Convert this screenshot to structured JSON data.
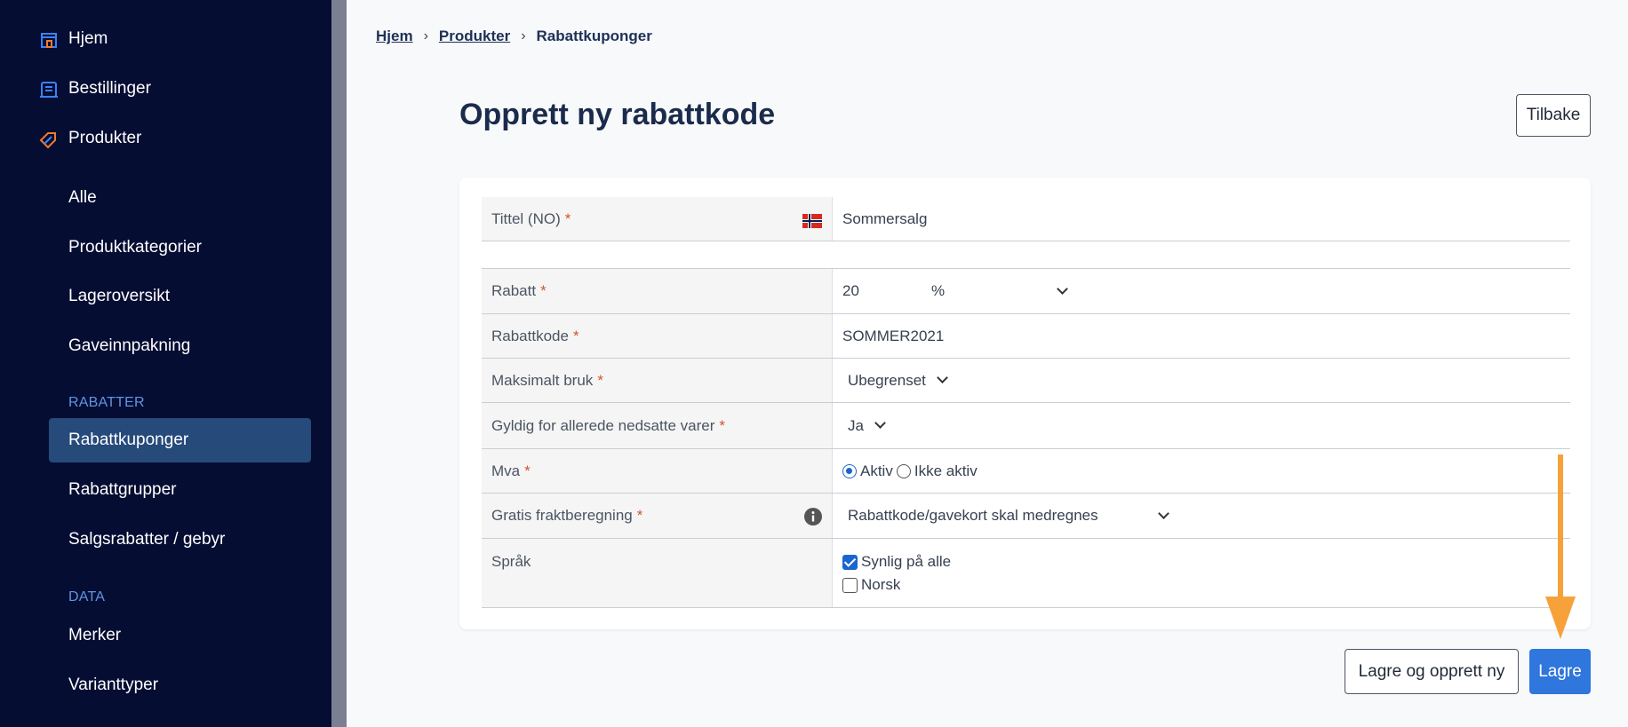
{
  "sidebar": {
    "top_items": [
      {
        "label": "Hjem",
        "icon": "home-icon"
      },
      {
        "label": "Bestillinger",
        "icon": "orders-icon"
      },
      {
        "label": "Produkter",
        "icon": "tag-icon"
      }
    ],
    "sub_items": [
      "Alle",
      "Produktkategorier",
      "Lageroversikt",
      "Gaveinnpakning"
    ],
    "section_rabatter": "RABATTER",
    "rabatter_items": [
      "Rabattkuponger",
      "Rabattgrupper",
      "Salgsrabatter / gebyr"
    ],
    "section_data": "DATA",
    "data_items": [
      "Merker",
      "Varianttyper"
    ],
    "active_item": "Rabattkuponger",
    "colors": {
      "background": "#050d33",
      "active": "#264a7a",
      "section": "#5f95e6",
      "icon_accent": "#f07b2b",
      "icon_blue": "#3b82f6"
    }
  },
  "breadcrumb": {
    "items": [
      "Hjem",
      "Produkter"
    ],
    "current": "Rabattkuponger",
    "separator": "›"
  },
  "page": {
    "title": "Opprett ny rabattkode",
    "back_label": "Tilbake"
  },
  "form": {
    "title_row": {
      "label": "Tittel (NO)",
      "required": "*",
      "flag_icon": "norway-flag-icon",
      "value": "Sommersalg"
    },
    "rabatt": {
      "label": "Rabatt",
      "required": "*",
      "value": "20",
      "unit": "%"
    },
    "rabattkode": {
      "label": "Rabattkode",
      "required": "*",
      "value": "SOMMER2021"
    },
    "maksimalt_bruk": {
      "label": "Maksimalt bruk",
      "required": "*",
      "value": "Ubegrenset"
    },
    "gyldig": {
      "label": "Gyldig for allerede nedsatte varer",
      "required": "*",
      "value": "Ja"
    },
    "mva": {
      "label": "Mva",
      "required": "*",
      "options": [
        "Aktiv",
        "Ikke aktiv"
      ],
      "selected": "Aktiv"
    },
    "gratis_frakt": {
      "label": "Gratis fraktberegning",
      "required": "*",
      "info_icon": "info-icon",
      "value": "Rabattkode/gavekort skal medregnes"
    },
    "sprak": {
      "label": "Språk",
      "options": [
        {
          "label": "Synlig på alle",
          "checked": true
        },
        {
          "label": "Norsk",
          "checked": false
        }
      ]
    }
  },
  "actions": {
    "save_new_label": "Lagre og opprett ny",
    "save_label": "Lagre",
    "primary_color": "#2f76dd",
    "annotation_arrow_color": "#f7a13a"
  }
}
